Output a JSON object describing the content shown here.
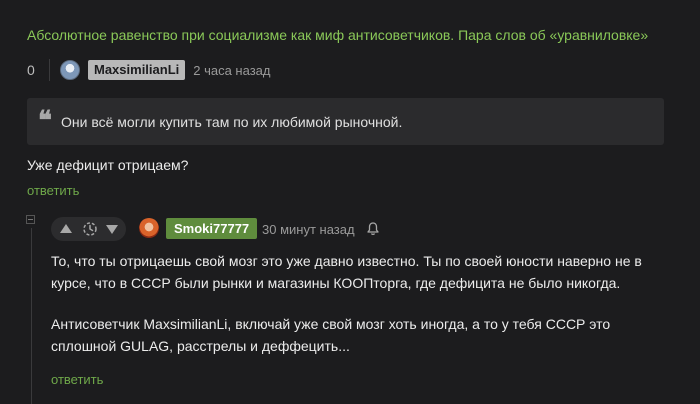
{
  "post": {
    "title": "Абсолютное равенство при социализме как миф антисоветчиков. Пара слов об «уравниловке»"
  },
  "comment1": {
    "rating": "0",
    "author": "MaxsimilianLi",
    "time": "2 часа назад",
    "quote": "Они всё могли купить там по их любимой рыночной.",
    "text": "Уже дефицит отрицаем?",
    "reply_label": "ответить"
  },
  "comment2": {
    "author": "Smoki77777",
    "time": "30 минут назад",
    "paragraphs": [
      "То, что ты отрицаешь свой мозг это уже давно известно. Ты по своей юности наверно не в курсе, что в СССР были рынки и магазины КООПторга, где дефицита не было никогда.",
      "Антисоветчик MaxsimilianLi, включай уже свой мозг хоть иногда, а то у тебя СССР это сплошной GULAG, расстрелы и деффецить..."
    ],
    "reply_label": "ответить"
  },
  "icons": {
    "quote": "quote-icon",
    "upvote": "upvote-arrow-icon",
    "downvote": "downvote-arrow-icon",
    "clock": "clock-icon",
    "bell": "bell-icon",
    "collapse": "collapse-icon"
  },
  "colors": {
    "accent_green": "#8ac858",
    "link_green": "#6fa84a",
    "author_badge_op": "#b8b8b8",
    "author_badge": "#5f8c3d",
    "background": "#1c1c1e"
  }
}
